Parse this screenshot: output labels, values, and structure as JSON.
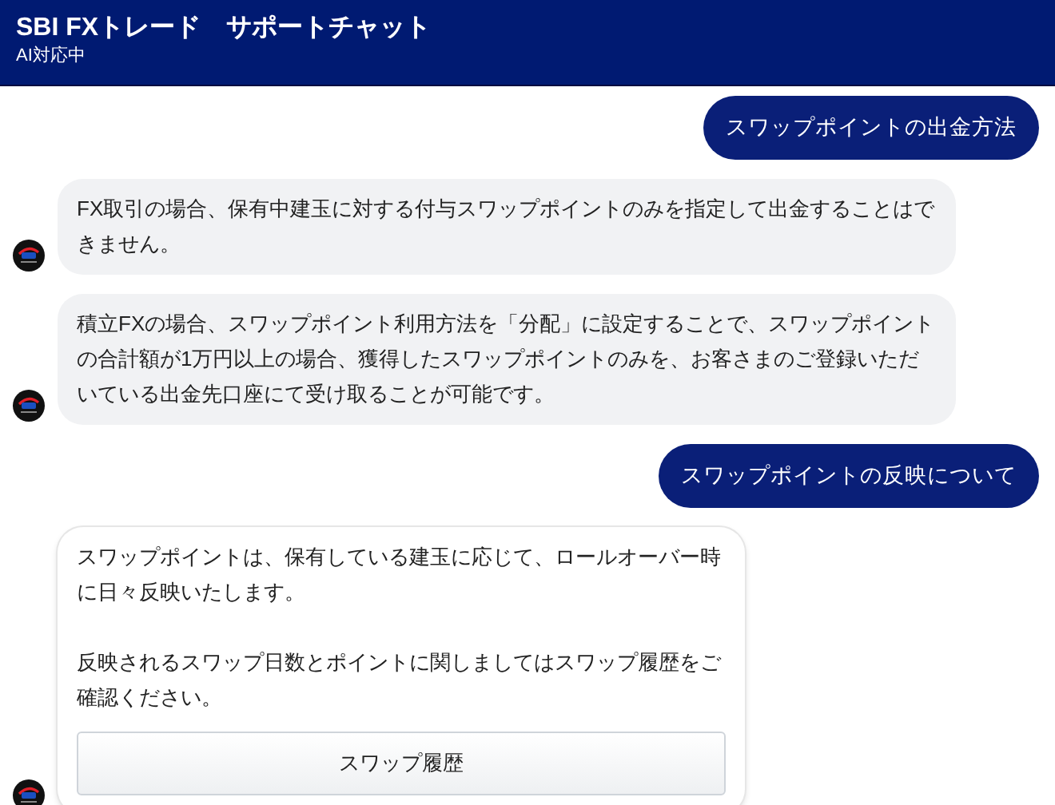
{
  "header": {
    "title": "SBI FXトレード　サポートチャット",
    "status": "AI対応中"
  },
  "messages": [
    {
      "kind": "user",
      "text": "スワップポイントの出金方法"
    },
    {
      "kind": "bot",
      "paragraphs": [
        "FX取引の場合、保有中建玉に対する付与スワップポイントのみを指定して出金することはできません。"
      ]
    },
    {
      "kind": "bot",
      "paragraphs": [
        "積立FXの場合、スワップポイント利用方法を「分配」に設定することで、スワップポイントの合計額が1万円以上の場合、獲得したスワップポイントのみを、お客さまのご登録いただいている出金先口座にて受け取ることが可能です。"
      ]
    },
    {
      "kind": "user",
      "text": "スワップポイントの反映について"
    },
    {
      "kind": "card",
      "paragraphs": [
        "スワップポイントは、保有している建玉に応じて、ロールオーバー時に日々反映いたします。",
        "反映されるスワップ日数とポイントに関しましてはスワップ履歴をご確認ください。"
      ],
      "button": "スワップ履歴"
    }
  ]
}
